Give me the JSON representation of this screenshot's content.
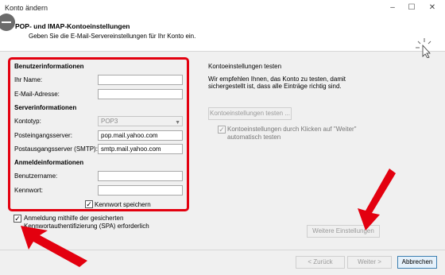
{
  "window": {
    "title": "Konto ändern"
  },
  "header": {
    "title": "POP- und IMAP-Kontoeinstellungen",
    "subtitle": "Geben Sie die E-Mail-Servereinstellungen für Ihr Konto ein."
  },
  "left": {
    "user_section": "Benutzerinformationen",
    "name_label": "Ihr Name:",
    "name_value": "",
    "email_label": "E-Mail-Adresse:",
    "email_value": "",
    "server_section": "Serverinformationen",
    "account_type_label": "Kontotyp:",
    "account_type_value": "POP3",
    "incoming_label": "Posteingangsserver:",
    "incoming_value": "pop.mail.yahoo.com",
    "outgoing_label": "Postausgangsserver (SMTP):",
    "outgoing_value": "smtp.mail.yahoo.com",
    "login_section": "Anmeldeinformationen",
    "username_label": "Benutzername:",
    "username_value": "",
    "password_label": "Kennwort:",
    "password_value": "",
    "remember_password_label": "Kennwort speichern",
    "spa_label_line1": "Anmeldung mithilfe der gesicherten",
    "spa_label_line2": "Kennwortauthentifizierung (SPA) erforderlich"
  },
  "right": {
    "test_title": "Kontoeinstellungen testen",
    "test_desc_line1": "Wir empfehlen Ihnen, das Konto zu testen, damit",
    "test_desc_line2": "sichergestellt ist, dass alle Einträge richtig sind.",
    "test_button": "Kontoeinstellungen testen ...",
    "auto_test_line1": "Kontoeinstellungen durch Klicken auf \"Weiter\"",
    "auto_test_line2": "automatisch testen",
    "more_settings_button": "Weitere Einstellungen"
  },
  "footer": {
    "back_button": "< Zurück",
    "next_button": "Weiter >",
    "cancel_button": "Abbrechen"
  },
  "colors": {
    "highlight": "#e3000f",
    "arrow": "#e3000f"
  },
  "icons": [
    "minimize-icon",
    "maximize-icon",
    "close-icon",
    "cursor-click-icon",
    "dropdown-arrow-icon",
    "checkmark-icon"
  ]
}
